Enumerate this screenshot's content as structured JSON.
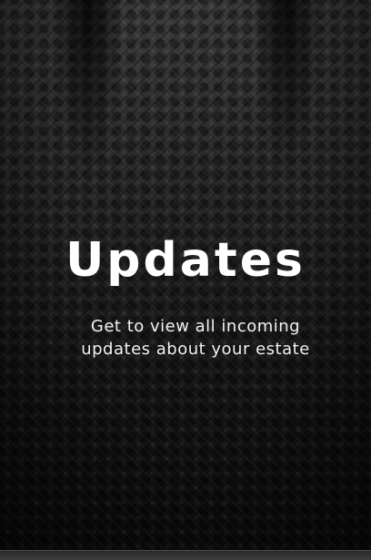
{
  "onboarding": {
    "title": "Updates",
    "description": "Get to view all incoming updates about your estate"
  },
  "colors": {
    "background": "#1e1e1e",
    "text": "#ffffff"
  }
}
